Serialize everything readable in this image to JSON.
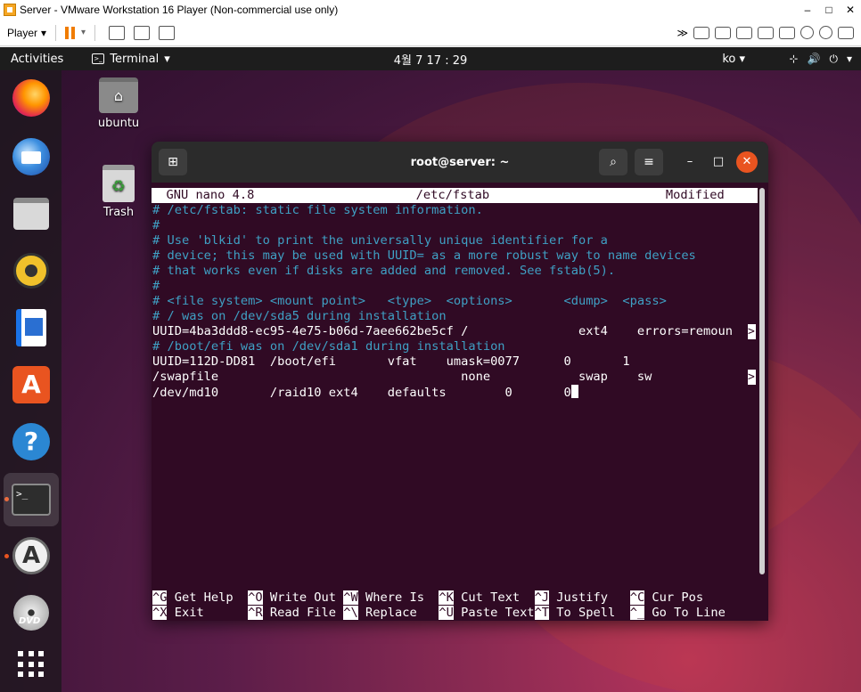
{
  "vmware": {
    "title": "Server - VMware Workstation 16 Player (Non-commercial use only)",
    "minimize": "–",
    "maximize": "□",
    "close": "✕",
    "player_menu": "Player",
    "player_caret": "▾",
    "more_devices": "≫"
  },
  "topbar": {
    "activities": "Activities",
    "app_name": "Terminal",
    "app_caret": "▾",
    "clock": "4월 7 17 : 29",
    "lang": "ko ▾",
    "network_icon": "⊹",
    "volume_icon": "🔊",
    "power_icon": "⏻",
    "status_caret": "▾"
  },
  "desktop": {
    "home_folder_label": "ubuntu",
    "trash_label": "Trash"
  },
  "dock": {
    "terminal_glyph": ">_",
    "software_glyph": "A",
    "help_glyph": "?",
    "updater_glyph": "A",
    "dvd_label": "DVD"
  },
  "terminal": {
    "title": "root@server: ~",
    "new_tab_glyph": "⊞",
    "search_glyph": "⌕",
    "menu_glyph": "≡",
    "min_glyph": "–",
    "max_glyph": "□",
    "close_glyph": "✕"
  },
  "nano": {
    "header": "  GNU nano 4.8                      /etc/fstab                        Modified  ",
    "lines": [
      {
        "text": "# /etc/fstab: static file system information.",
        "type": "comment"
      },
      {
        "text": "#",
        "type": "comment"
      },
      {
        "text": "# Use 'blkid' to print the universally unique identifier for a",
        "type": "comment"
      },
      {
        "text": "# device; this may be used with UUID= as a more robust way to name devices",
        "type": "comment"
      },
      {
        "text": "# that works even if disks are added and removed. See fstab(5).",
        "type": "comment"
      },
      {
        "text": "#",
        "type": "comment"
      },
      {
        "text": "# <file system> <mount point>   <type>  <options>       <dump>  <pass>",
        "type": "comment"
      },
      {
        "text": "# / was on /dev/sda5 during installation",
        "type": "comment"
      },
      {
        "text": "UUID=4ba3ddd8-ec95-4e75-b06d-7aee662be5cf /               ext4    errors=remoun",
        "type": "text"
      },
      {
        "text": "# /boot/efi was on /dev/sda1 during installation",
        "type": "comment"
      },
      {
        "text": "UUID=112D-DD81  /boot/efi       vfat    umask=0077      0       1",
        "type": "text"
      },
      {
        "text": "/swapfile                                 none            swap    sw",
        "type": "text"
      },
      {
        "text": "/dev/md10       /raid10 ext4    defaults        0       0",
        "type": "text"
      }
    ],
    "overflow_marker": ">",
    "shortcuts_row1": [
      {
        "key": "^G",
        "label": " Get Help  "
      },
      {
        "key": "^O",
        "label": " Write Out "
      },
      {
        "key": "^W",
        "label": " Where Is  "
      },
      {
        "key": "^K",
        "label": " Cut Text  "
      },
      {
        "key": "^J",
        "label": " Justify   "
      },
      {
        "key": "^C",
        "label": " Cur Pos"
      }
    ],
    "shortcuts_row2": [
      {
        "key": "^X",
        "label": " Exit      "
      },
      {
        "key": "^R",
        "label": " Read File "
      },
      {
        "key": "^\\",
        "label": " Replace   "
      },
      {
        "key": "^U",
        "label": " Paste Text"
      },
      {
        "key": "^T",
        "label": " To Spell  "
      },
      {
        "key": "^_",
        "label": " Go To Line"
      }
    ]
  }
}
